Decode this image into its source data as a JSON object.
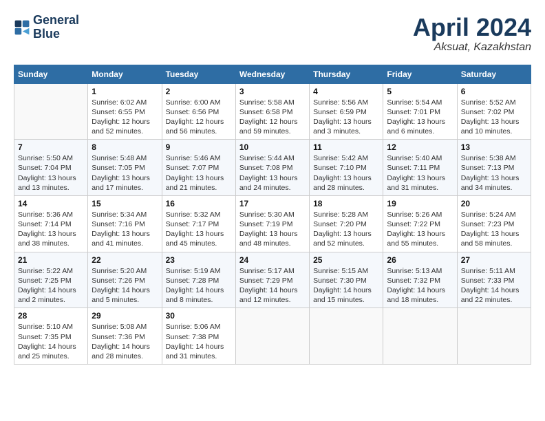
{
  "header": {
    "logo_line1": "General",
    "logo_line2": "Blue",
    "title": "April 2024",
    "location": "Aksuat, Kazakhstan"
  },
  "weekdays": [
    "Sunday",
    "Monday",
    "Tuesday",
    "Wednesday",
    "Thursday",
    "Friday",
    "Saturday"
  ],
  "weeks": [
    [
      {
        "day": "",
        "info": ""
      },
      {
        "day": "1",
        "info": "Sunrise: 6:02 AM\nSunset: 6:55 PM\nDaylight: 12 hours\nand 52 minutes."
      },
      {
        "day": "2",
        "info": "Sunrise: 6:00 AM\nSunset: 6:56 PM\nDaylight: 12 hours\nand 56 minutes."
      },
      {
        "day": "3",
        "info": "Sunrise: 5:58 AM\nSunset: 6:58 PM\nDaylight: 12 hours\nand 59 minutes."
      },
      {
        "day": "4",
        "info": "Sunrise: 5:56 AM\nSunset: 6:59 PM\nDaylight: 13 hours\nand 3 minutes."
      },
      {
        "day": "5",
        "info": "Sunrise: 5:54 AM\nSunset: 7:01 PM\nDaylight: 13 hours\nand 6 minutes."
      },
      {
        "day": "6",
        "info": "Sunrise: 5:52 AM\nSunset: 7:02 PM\nDaylight: 13 hours\nand 10 minutes."
      }
    ],
    [
      {
        "day": "7",
        "info": "Sunrise: 5:50 AM\nSunset: 7:04 PM\nDaylight: 13 hours\nand 13 minutes."
      },
      {
        "day": "8",
        "info": "Sunrise: 5:48 AM\nSunset: 7:05 PM\nDaylight: 13 hours\nand 17 minutes."
      },
      {
        "day": "9",
        "info": "Sunrise: 5:46 AM\nSunset: 7:07 PM\nDaylight: 13 hours\nand 21 minutes."
      },
      {
        "day": "10",
        "info": "Sunrise: 5:44 AM\nSunset: 7:08 PM\nDaylight: 13 hours\nand 24 minutes."
      },
      {
        "day": "11",
        "info": "Sunrise: 5:42 AM\nSunset: 7:10 PM\nDaylight: 13 hours\nand 28 minutes."
      },
      {
        "day": "12",
        "info": "Sunrise: 5:40 AM\nSunset: 7:11 PM\nDaylight: 13 hours\nand 31 minutes."
      },
      {
        "day": "13",
        "info": "Sunrise: 5:38 AM\nSunset: 7:13 PM\nDaylight: 13 hours\nand 34 minutes."
      }
    ],
    [
      {
        "day": "14",
        "info": "Sunrise: 5:36 AM\nSunset: 7:14 PM\nDaylight: 13 hours\nand 38 minutes."
      },
      {
        "day": "15",
        "info": "Sunrise: 5:34 AM\nSunset: 7:16 PM\nDaylight: 13 hours\nand 41 minutes."
      },
      {
        "day": "16",
        "info": "Sunrise: 5:32 AM\nSunset: 7:17 PM\nDaylight: 13 hours\nand 45 minutes."
      },
      {
        "day": "17",
        "info": "Sunrise: 5:30 AM\nSunset: 7:19 PM\nDaylight: 13 hours\nand 48 minutes."
      },
      {
        "day": "18",
        "info": "Sunrise: 5:28 AM\nSunset: 7:20 PM\nDaylight: 13 hours\nand 52 minutes."
      },
      {
        "day": "19",
        "info": "Sunrise: 5:26 AM\nSunset: 7:22 PM\nDaylight: 13 hours\nand 55 minutes."
      },
      {
        "day": "20",
        "info": "Sunrise: 5:24 AM\nSunset: 7:23 PM\nDaylight: 13 hours\nand 58 minutes."
      }
    ],
    [
      {
        "day": "21",
        "info": "Sunrise: 5:22 AM\nSunset: 7:25 PM\nDaylight: 14 hours\nand 2 minutes."
      },
      {
        "day": "22",
        "info": "Sunrise: 5:20 AM\nSunset: 7:26 PM\nDaylight: 14 hours\nand 5 minutes."
      },
      {
        "day": "23",
        "info": "Sunrise: 5:19 AM\nSunset: 7:28 PM\nDaylight: 14 hours\nand 8 minutes."
      },
      {
        "day": "24",
        "info": "Sunrise: 5:17 AM\nSunset: 7:29 PM\nDaylight: 14 hours\nand 12 minutes."
      },
      {
        "day": "25",
        "info": "Sunrise: 5:15 AM\nSunset: 7:30 PM\nDaylight: 14 hours\nand 15 minutes."
      },
      {
        "day": "26",
        "info": "Sunrise: 5:13 AM\nSunset: 7:32 PM\nDaylight: 14 hours\nand 18 minutes."
      },
      {
        "day": "27",
        "info": "Sunrise: 5:11 AM\nSunset: 7:33 PM\nDaylight: 14 hours\nand 22 minutes."
      }
    ],
    [
      {
        "day": "28",
        "info": "Sunrise: 5:10 AM\nSunset: 7:35 PM\nDaylight: 14 hours\nand 25 minutes."
      },
      {
        "day": "29",
        "info": "Sunrise: 5:08 AM\nSunset: 7:36 PM\nDaylight: 14 hours\nand 28 minutes."
      },
      {
        "day": "30",
        "info": "Sunrise: 5:06 AM\nSunset: 7:38 PM\nDaylight: 14 hours\nand 31 minutes."
      },
      {
        "day": "",
        "info": ""
      },
      {
        "day": "",
        "info": ""
      },
      {
        "day": "",
        "info": ""
      },
      {
        "day": "",
        "info": ""
      }
    ]
  ]
}
